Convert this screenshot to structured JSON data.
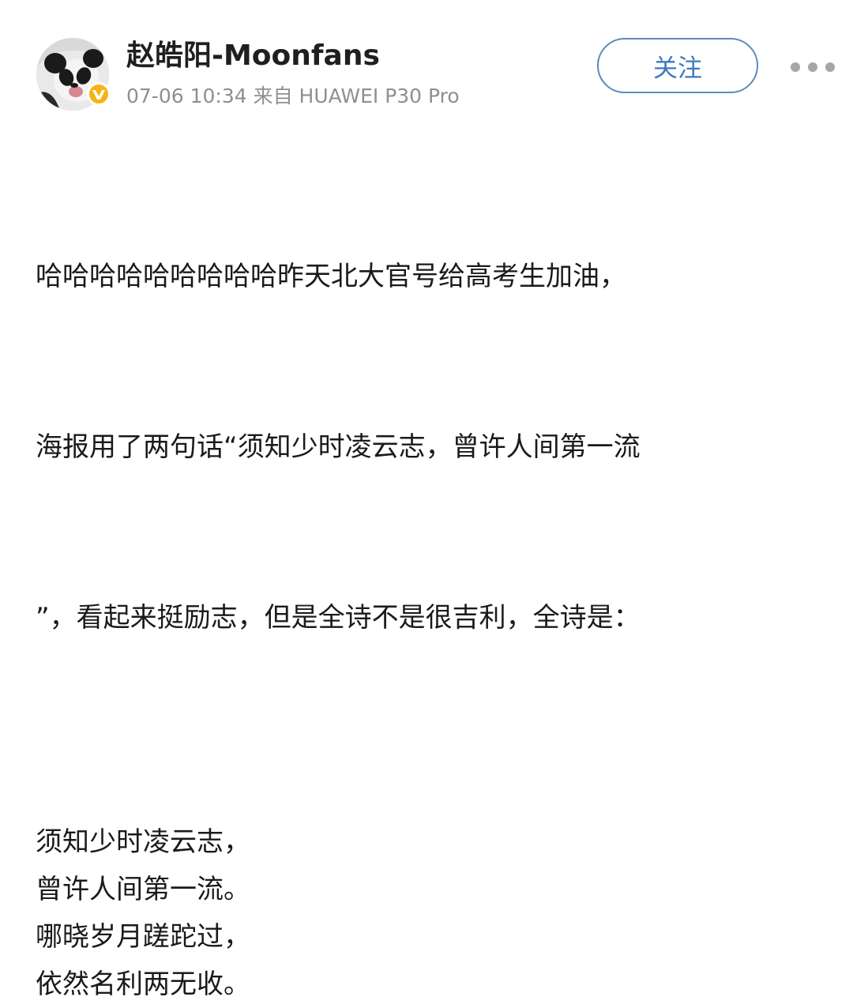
{
  "post": {
    "author": {
      "name": "赵皓阳-Moonfans",
      "avatar_icon": "panda-avatar",
      "badge_icon": "vip-badge-icon",
      "badge_color": "#f5b316"
    },
    "meta": "07-06 10:34 来自 HUAWEI P30 Pro",
    "follow_label": "关注",
    "more_icon": "more-dots-icon",
    "body_lines": [
      "哈哈哈哈哈哈哈哈哈昨天北大官号给高考生加油，",
      "海报用了两句话“须知少时凌云志，曾许人间第一流",
      "”，看起来挺励志，但是全诗不是很吉利，全诗是："
    ],
    "poem_lines": [
      "须知少时凌云志，",
      "曾许人间第一流。",
      "哪晓岁月蹉跎过，",
      "依然名利两无收。"
    ]
  },
  "colors": {
    "accent": "#3f78bd",
    "follow_border": "#5e8bbd",
    "meta_text": "#8f8f8f",
    "text": "#1a1a1a"
  }
}
